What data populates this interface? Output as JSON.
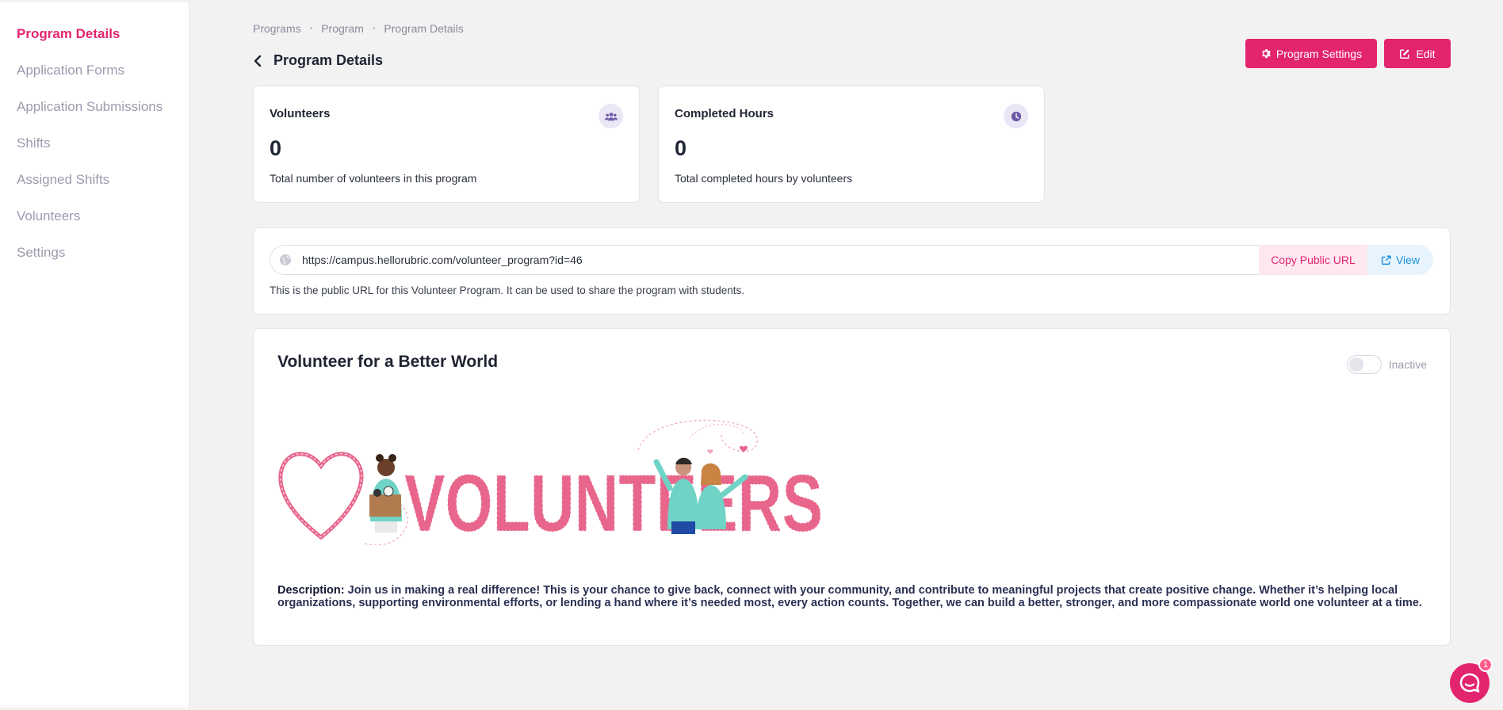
{
  "sidebar": {
    "items": [
      {
        "label": "Program Details",
        "active": true
      },
      {
        "label": "Application Forms"
      },
      {
        "label": "Application Submissions"
      },
      {
        "label": "Shifts"
      },
      {
        "label": "Assigned Shifts"
      },
      {
        "label": "Volunteers"
      },
      {
        "label": "Settings"
      }
    ]
  },
  "breadcrumb": [
    "Programs",
    "Program",
    "Program Details"
  ],
  "header": {
    "title": "Program Details",
    "settings_label": "Program Settings",
    "edit_label": "Edit"
  },
  "stats": [
    {
      "title": "Volunteers",
      "value": "0",
      "desc": "Total number of volunteers in this program",
      "icon": "users-icon"
    },
    {
      "title": "Completed Hours",
      "value": "0",
      "desc": "Total completed hours by volunteers",
      "icon": "clock-icon"
    }
  ],
  "public_url": {
    "value": "https://campus.hellorubric.com/volunteer_program?id=46",
    "copy_label": "Copy Public URL",
    "view_label": "View",
    "note": "This is the public URL for this Volunteer Program. It can be used to share the program with students."
  },
  "program": {
    "title": "Volunteer for a Better World",
    "status_label": "Inactive",
    "active": false,
    "banner_text": "VOLUNTEERS",
    "description_label": "Description:",
    "description": "Join us in making a real difference! This is your chance to give back, connect with your community, and contribute to meaningful projects that create positive change. Whether it’s helping local organizations, supporting environmental efforts, or lending a hand where it’s needed most, every action counts. Together, we can build a better, stronger, and more compassionate world one volunteer at a time."
  },
  "chat": {
    "badge": "1"
  },
  "colors": {
    "accent": "#e3246f",
    "link": "#1a8fe0",
    "background": "#f2f2f3"
  }
}
